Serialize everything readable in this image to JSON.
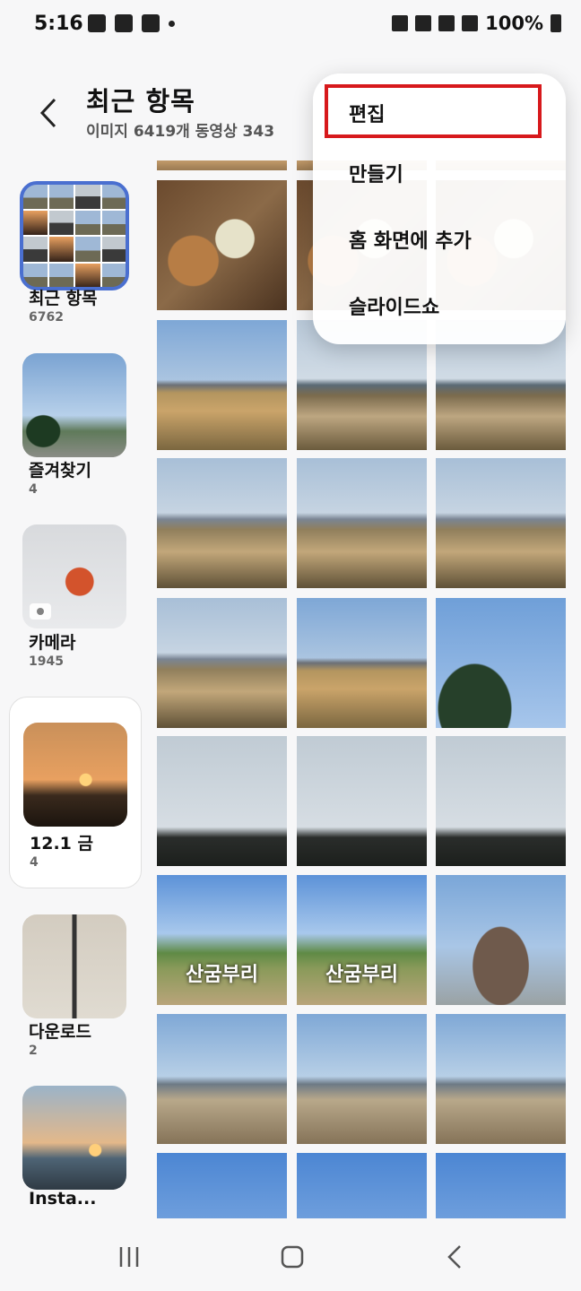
{
  "status": {
    "time": "5:16",
    "battery": "100%"
  },
  "header": {
    "title": "최근 항목",
    "subtitle": "이미지 6419개 동영상 343"
  },
  "albums": [
    {
      "name": "최근 항목",
      "count": "6762"
    },
    {
      "name": "즐겨찾기",
      "count": "4"
    },
    {
      "name": "카메라",
      "count": "1945"
    },
    {
      "name": "12.1 금",
      "count": "4"
    },
    {
      "name": "다운로드",
      "count": "2"
    },
    {
      "name": "Insta...",
      "count": ""
    }
  ],
  "photo_text": {
    "sanbumbu": "산굼부리"
  },
  "menu": {
    "items": [
      "편집",
      "만들기",
      "홈 화면에 추가",
      "슬라이드쇼"
    ]
  },
  "colors": {
    "highlight": "#d7191c",
    "selected": "#4a6fd0"
  }
}
